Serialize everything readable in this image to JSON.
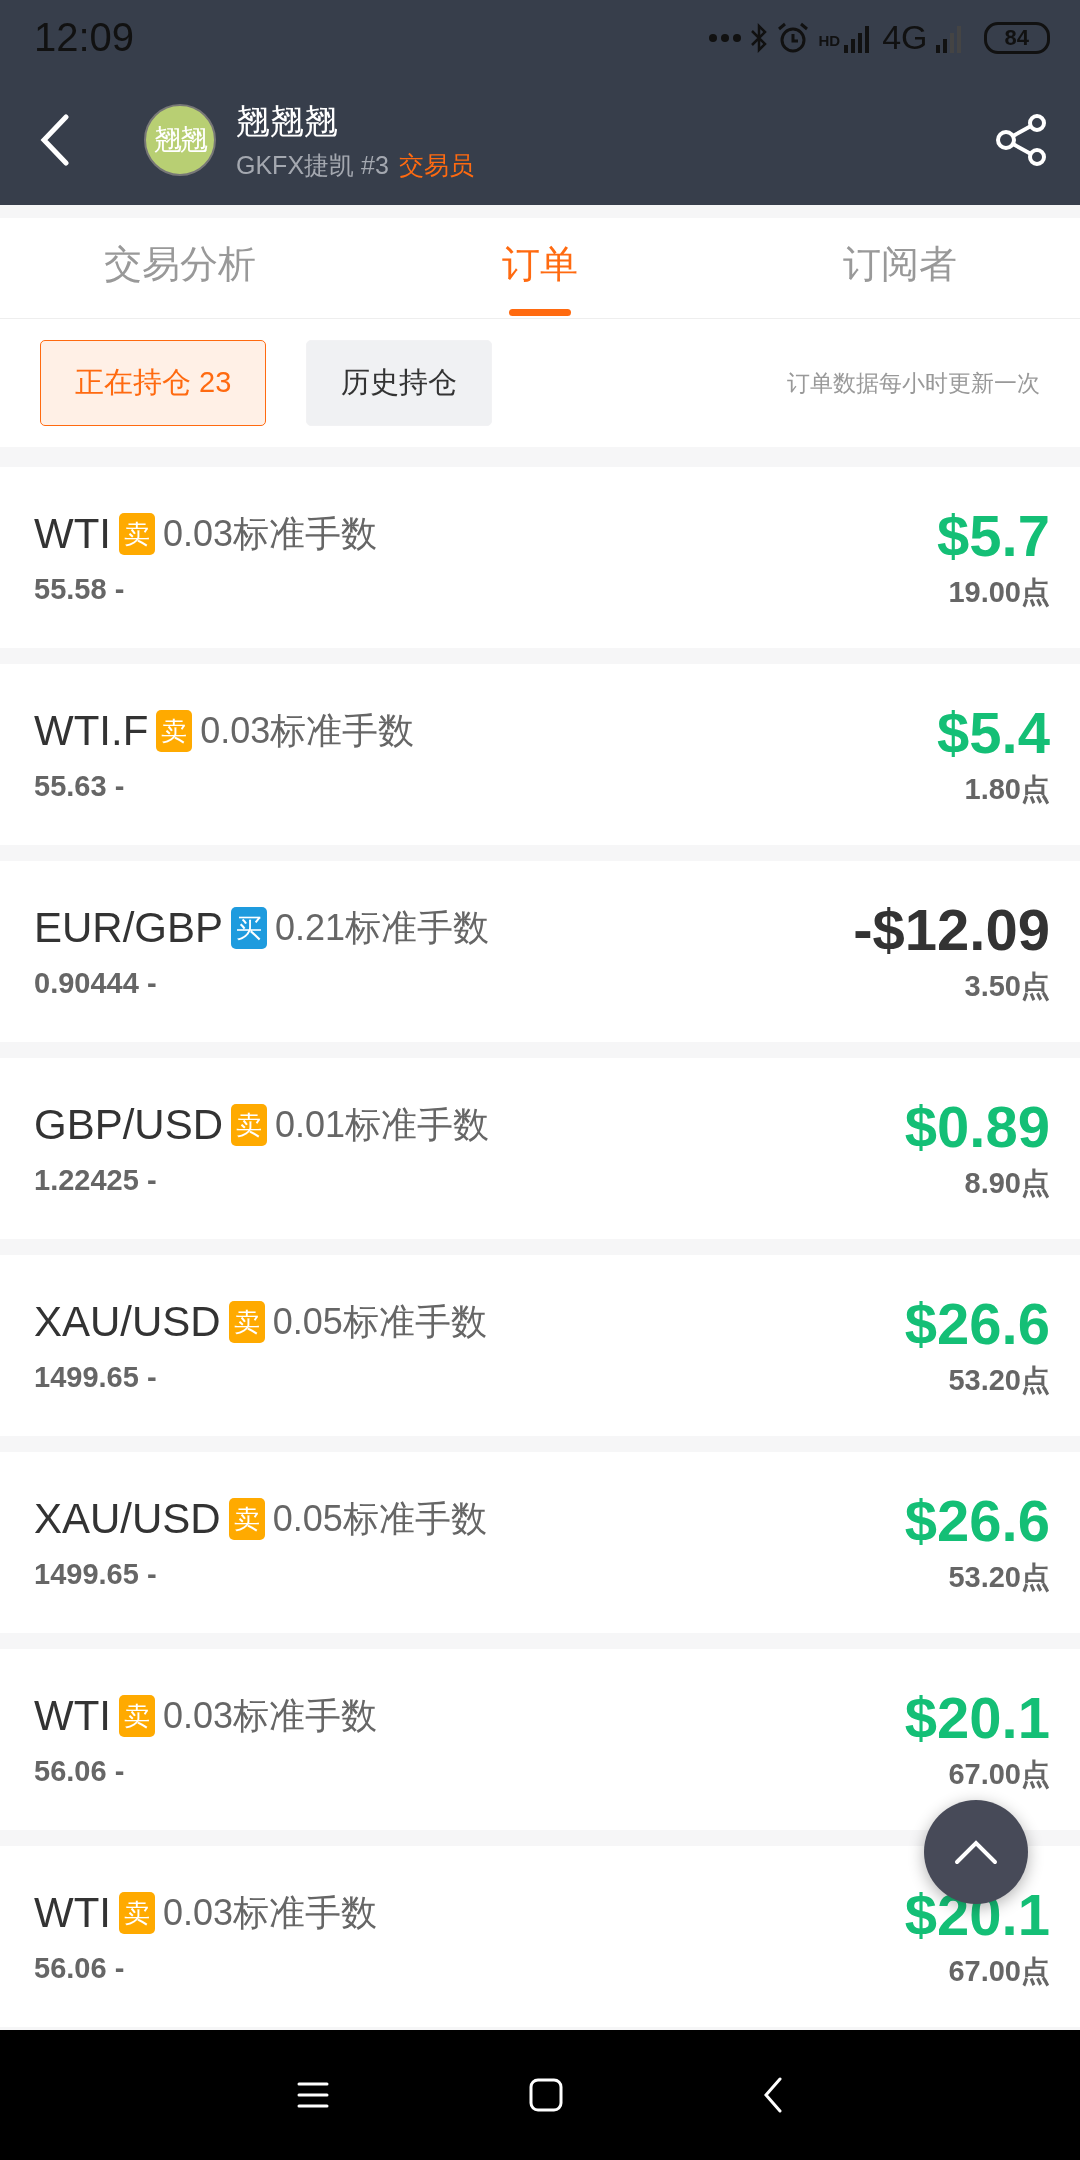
{
  "status_bar": {
    "time": "12:09",
    "network_hd": "HD",
    "network": "4G",
    "battery": "84"
  },
  "header": {
    "avatar_text": "翘翘",
    "name": "翘翘翘",
    "subtitle": "GKFX捷凯 #3",
    "role": "交易员"
  },
  "tabs": [
    {
      "label": "交易分析",
      "selected": false
    },
    {
      "label": "订单",
      "selected": true
    },
    {
      "label": "订阅者",
      "selected": false
    }
  ],
  "filters": [
    {
      "label": "正在持仓 23",
      "selected": true
    },
    {
      "label": "历史持仓",
      "selected": false
    }
  ],
  "update_note": "订单数据每小时更新一次",
  "orders": [
    {
      "symbol": "WTI",
      "kind": "sell",
      "side": "卖",
      "lots": "0.03标准手数",
      "price": "55.58 -",
      "profit": "$5.7",
      "color": "#14bf76",
      "points": "19.00点"
    },
    {
      "symbol": "WTI.F",
      "kind": "sell",
      "side": "卖",
      "lots": "0.03标准手数",
      "price": "55.63 -",
      "profit": "$5.4",
      "color": "#14bf76",
      "points": "1.80点"
    },
    {
      "symbol": "EUR/GBP",
      "kind": "buy",
      "side": "买",
      "lots": "0.21标准手数",
      "price": "0.90444 -",
      "profit": "-$12.09",
      "color": "#333333",
      "points": "3.50点"
    },
    {
      "symbol": "GBP/USD",
      "kind": "sell",
      "side": "卖",
      "lots": "0.01标准手数",
      "price": "1.22425 -",
      "profit": "$0.89",
      "color": "#14bf76",
      "points": "8.90点"
    },
    {
      "symbol": "XAU/USD",
      "kind": "sell",
      "side": "卖",
      "lots": "0.05标准手数",
      "price": "1499.65 -",
      "profit": "$26.6",
      "color": "#14bf76",
      "points": "53.20点"
    },
    {
      "symbol": "XAU/USD",
      "kind": "sell",
      "side": "卖",
      "lots": "0.05标准手数",
      "price": "1499.65 -",
      "profit": "$26.6",
      "color": "#14bf76",
      "points": "53.20点"
    },
    {
      "symbol": "WTI",
      "kind": "sell",
      "side": "卖",
      "lots": "0.03标准手数",
      "price": "56.06 -",
      "profit": "$20.1",
      "color": "#14bf76",
      "points": "67.00点"
    },
    {
      "symbol": "WTI",
      "kind": "sell",
      "side": "卖",
      "lots": "0.03标准手数",
      "price": "56.06 -",
      "profit": "$20.1",
      "color": "#14bf76",
      "points": "67.00点"
    }
  ]
}
